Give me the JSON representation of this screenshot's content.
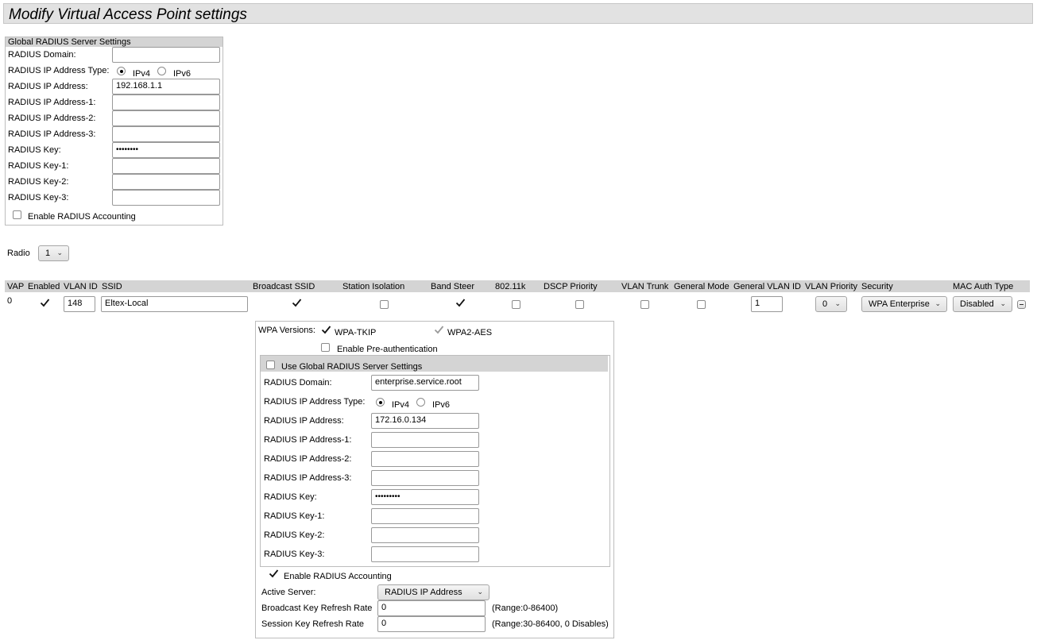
{
  "page_title": "Modify Virtual Access Point settings",
  "global_radius": {
    "section_title": "Global RADIUS Server Settings",
    "domain_label": "RADIUS Domain:",
    "domain_value": "",
    "ip_type_label": "RADIUS IP Address Type:",
    "ipv4_label": "IPv4",
    "ipv6_label": "IPv6",
    "ip_type_selected": "IPv4",
    "ip_label": "RADIUS IP Address:",
    "ip_value": "192.168.1.1",
    "ip1_label": "RADIUS IP Address-1:",
    "ip1_value": "",
    "ip2_label": "RADIUS IP Address-2:",
    "ip2_value": "",
    "ip3_label": "RADIUS IP Address-3:",
    "ip3_value": "",
    "key_label": "RADIUS Key:",
    "key_value": "••••••••",
    "key1_label": "RADIUS Key-1:",
    "key1_value": "",
    "key2_label": "RADIUS Key-2:",
    "key2_value": "",
    "key3_label": "RADIUS Key-3:",
    "key3_value": "",
    "accounting_label": "Enable RADIUS Accounting",
    "accounting_checked": false
  },
  "radio": {
    "label": "Radio",
    "selected": "1"
  },
  "vap_table": {
    "headers": {
      "vap": "VAP",
      "enabled": "Enabled",
      "vlan_id": "VLAN ID",
      "ssid": "SSID",
      "broadcast_ssid": "Broadcast SSID",
      "station_isolation": "Station Isolation",
      "band_steer": "Band Steer",
      "dot11k": "802.11k",
      "dscp_priority": "DSCP Priority",
      "vlan_trunk": "VLAN Trunk",
      "general_mode": "General Mode",
      "general_vlan_id": "General VLAN ID",
      "vlan_priority": "VLAN Priority",
      "security": "Security",
      "mac_auth_type": "MAC Auth Type"
    },
    "row": {
      "vap": "0",
      "enabled": true,
      "vlan_id": "148",
      "ssid": "Eltex-Local",
      "broadcast_ssid": true,
      "station_isolation": false,
      "band_steer": true,
      "dot11k": false,
      "dscp_priority": false,
      "vlan_trunk": false,
      "general_mode": false,
      "general_vlan_id": "1",
      "vlan_priority": "0",
      "security": "WPA Enterprise",
      "mac_auth_type": "Disabled"
    }
  },
  "wpa": {
    "versions_label": "WPA Versions:",
    "tkip_label": "WPA-TKIP",
    "tkip_checked": true,
    "aes_label": "WPA2-AES",
    "aes_checked": true,
    "preauth_label": "Enable Pre-authentication",
    "preauth_checked": false,
    "use_global_label": "Use Global RADIUS Server Settings",
    "use_global_checked": false,
    "radius": {
      "domain_label": "RADIUS Domain:",
      "domain_value": "enterprise.service.root",
      "ip_type_label": "RADIUS IP Address Type:",
      "ipv4_label": "IPv4",
      "ipv6_label": "IPv6",
      "ip_type_selected": "IPv4",
      "ip_label": "RADIUS IP Address:",
      "ip_value": "172.16.0.134",
      "ip1_label": "RADIUS IP Address-1:",
      "ip1_value": "",
      "ip2_label": "RADIUS IP Address-2:",
      "ip2_value": "",
      "ip3_label": "RADIUS IP Address-3:",
      "ip3_value": "",
      "key_label": "RADIUS Key:",
      "key_value": "•••••••••",
      "key1_label": "RADIUS Key-1:",
      "key1_value": "",
      "key2_label": "RADIUS Key-2:",
      "key2_value": "",
      "key3_label": "RADIUS Key-3:",
      "key3_value": ""
    },
    "accounting_label": "Enable RADIUS Accounting",
    "accounting_checked": true,
    "active_server_label": "Active Server:",
    "active_server_value": "RADIUS IP Address",
    "bcast_refresh_label": "Broadcast Key Refresh Rate",
    "bcast_refresh_value": "0",
    "bcast_range": "(Range:0-86400)",
    "session_refresh_label": "Session Key Refresh Rate",
    "session_refresh_value": "0",
    "session_range": "(Range:30-86400, 0 Disables)"
  }
}
